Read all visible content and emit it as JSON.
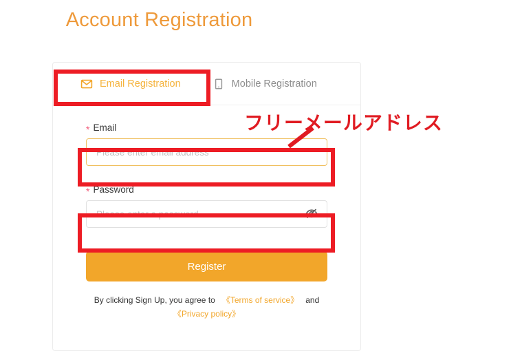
{
  "page": {
    "title": "Account Registration",
    "title_color": "#ee9a3b",
    "background": "#ffffff"
  },
  "tabs": [
    {
      "id": "email",
      "label": "Email Registration",
      "icon": "envelope-icon",
      "active": true,
      "color": "#f5b33c"
    },
    {
      "id": "mobile",
      "label": "Mobile Registration",
      "icon": "mobile-phone-icon",
      "active": false,
      "color": "#8c8c8c"
    }
  ],
  "form": {
    "required_marker": "*",
    "email": {
      "label": "Email",
      "placeholder": "Please enter email address",
      "value": "",
      "focused": true,
      "border_color": "#f0c060"
    },
    "password": {
      "label": "Password",
      "placeholder": "Please enter a password",
      "value": "",
      "focused": false,
      "border_color": "#e0e0e0",
      "toggle_icon": "eye-slash-icon"
    },
    "submit": {
      "label": "Register",
      "background": "#f2a62a",
      "text_color": "#ffffff"
    }
  },
  "terms": {
    "prefix": "By clicking Sign Up, you agree to",
    "terms_link": "《Terms of service》",
    "conjunction": "and",
    "privacy_link": "《Privacy policy》",
    "link_color": "#f2a62a"
  },
  "annotations": {
    "color": "#ed1c24",
    "note_text": "フリーメールアドレス",
    "boxes": [
      {
        "name": "tab-highlight"
      },
      {
        "name": "email-field-highlight"
      },
      {
        "name": "password-field-highlight"
      }
    ]
  }
}
